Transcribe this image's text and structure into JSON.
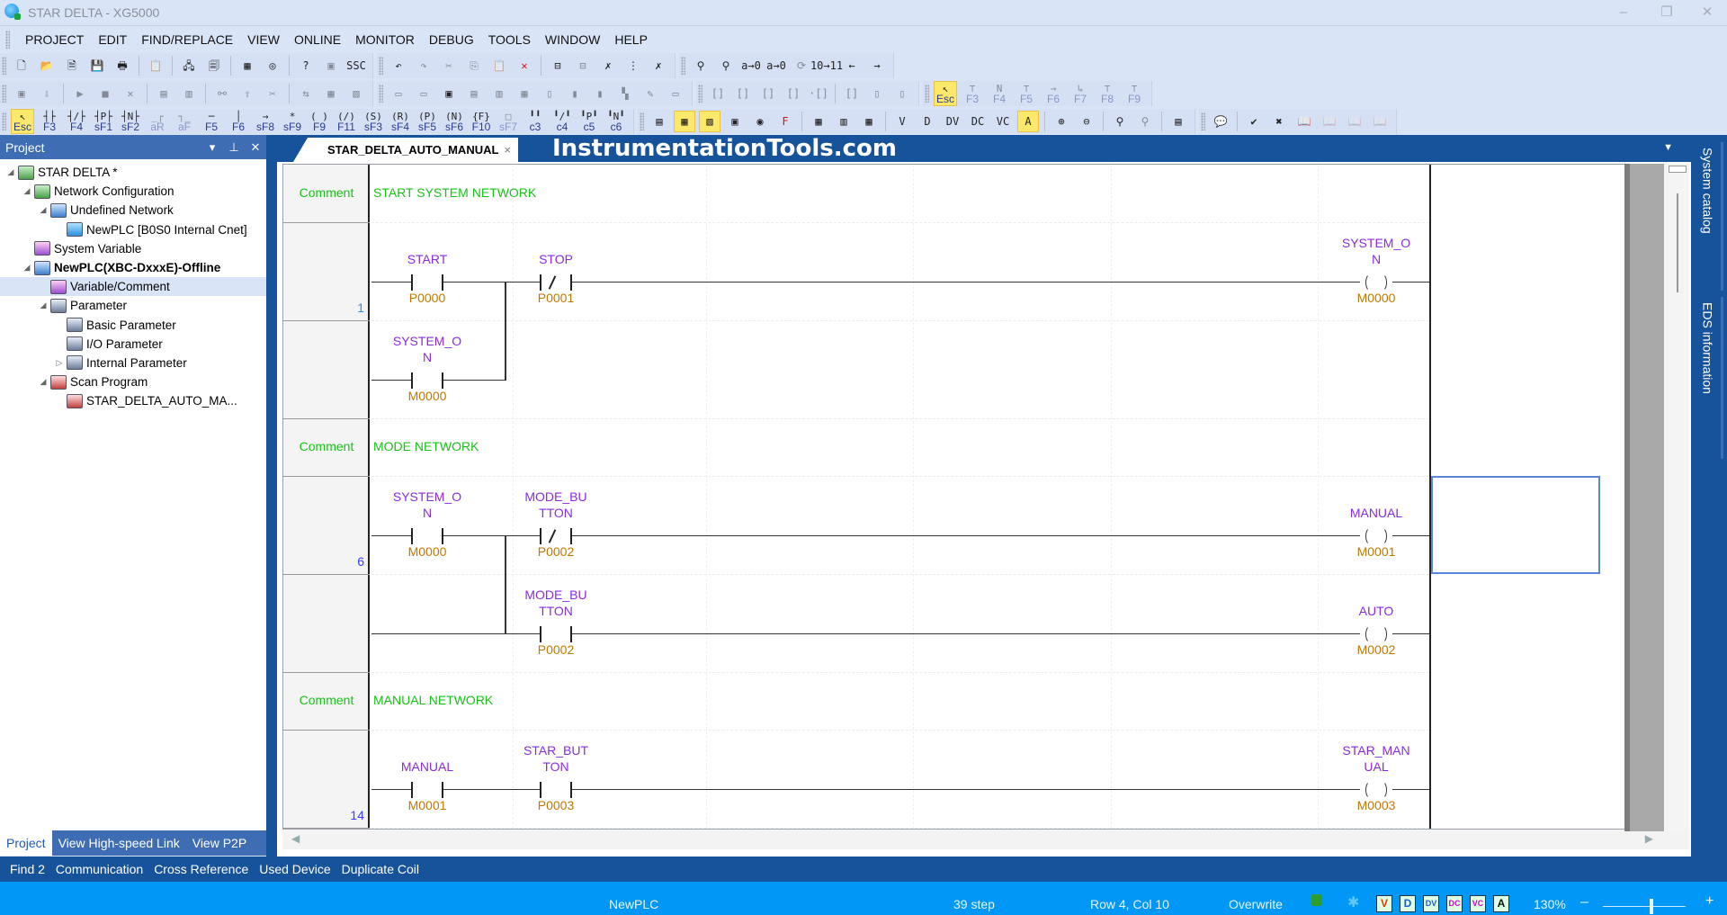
{
  "window": {
    "title": "STAR DELTA - XG5000",
    "minimize": "–",
    "restore": "❐",
    "close": "✕"
  },
  "menu": [
    "PROJECT",
    "EDIT",
    "FIND/REPLACE",
    "VIEW",
    "ONLINE",
    "MONITOR",
    "DEBUG",
    "TOOLS",
    "WINDOW",
    "HELP"
  ],
  "toolbar": {
    "row1": [
      {
        "name": "new-project-icon",
        "glyph": "🗋"
      },
      {
        "name": "open-project-icon",
        "glyph": "📂"
      },
      {
        "name": "open-from-plc-icon",
        "glyph": "🗎"
      },
      {
        "name": "save-icon",
        "glyph": "💾"
      },
      {
        "name": "print-icon",
        "glyph": "🖶"
      },
      {
        "name": "sep"
      },
      {
        "name": "clipboard-icon",
        "glyph": "📋",
        "dis": true
      },
      {
        "name": "sep"
      },
      {
        "name": "connect-icon",
        "glyph": "🖧"
      },
      {
        "name": "project-compare-icon",
        "glyph": "🗐"
      },
      {
        "name": "sep"
      },
      {
        "name": "io-sync-icon",
        "glyph": "▦"
      },
      {
        "name": "variable-icon",
        "glyph": "◎"
      },
      {
        "name": "sep"
      },
      {
        "name": "help-icon",
        "glyph": "?"
      },
      {
        "name": "help-topics-icon",
        "glyph": "▣",
        "dis": true
      },
      {
        "name": "ssc-icon",
        "glyph": "SSC"
      },
      {
        "name": "grp"
      },
      {
        "name": "undo-icon",
        "glyph": "↶"
      },
      {
        "name": "redo-icon",
        "glyph": "↷",
        "dis": true
      },
      {
        "name": "cut-icon",
        "glyph": "✂",
        "dis": true
      },
      {
        "name": "copy-icon",
        "glyph": "⎘",
        "dis": true
      },
      {
        "name": "paste-icon",
        "glyph": "📋",
        "dis": true
      },
      {
        "name": "delete-icon",
        "glyph": "✕",
        "red": true
      },
      {
        "name": "sep"
      },
      {
        "name": "insert-line-icon",
        "glyph": "⊟"
      },
      {
        "name": "delete-line-icon",
        "glyph": "⊟",
        "dis": true
      },
      {
        "name": "delete-cell-icon",
        "glyph": "✗"
      },
      {
        "name": "insert-column-icon",
        "glyph": "⋮"
      },
      {
        "name": "delete-column-icon",
        "glyph": "✗"
      },
      {
        "name": "grp"
      },
      {
        "name": "find-device-icon",
        "glyph": "⚲"
      },
      {
        "name": "find-icon",
        "glyph": "⚲"
      },
      {
        "name": "replace-device-icon",
        "glyph": "a→0"
      },
      {
        "name": "replace-icon",
        "glyph": "a→0"
      },
      {
        "name": "find-again-icon",
        "glyph": "⟳",
        "dis": true
      },
      {
        "name": "goto-step-icon",
        "glyph": "10→11"
      },
      {
        "name": "back-icon",
        "glyph": "←"
      },
      {
        "name": "forward-icon",
        "glyph": "→"
      }
    ],
    "row2": [
      {
        "name": "plc-mode-icon",
        "glyph": "▣",
        "dis": true
      },
      {
        "name": "write-icon",
        "glyph": "⇩",
        "dis": true
      },
      {
        "name": "sep"
      },
      {
        "name": "run-icon",
        "glyph": "▶",
        "dis": true
      },
      {
        "name": "stop-icon",
        "glyph": "■",
        "dis": true
      },
      {
        "name": "pause-icon",
        "glyph": "✕",
        "dis": true
      },
      {
        "name": "sep"
      },
      {
        "name": "reset-icon",
        "glyph": "▤",
        "dis": true
      },
      {
        "name": "clear-icon",
        "glyph": "▥",
        "dis": true
      },
      {
        "name": "sep"
      },
      {
        "name": "connect-plc-icon",
        "glyph": "⚯",
        "dis": true
      },
      {
        "name": "read-icon",
        "glyph": "⇧",
        "dis": true
      },
      {
        "name": "disconnect-icon",
        "glyph": "✂",
        "dis": true
      },
      {
        "name": "sep"
      },
      {
        "name": "compare-icon",
        "glyph": "⇆",
        "dis": true
      },
      {
        "name": "online-edit-icon",
        "glyph": "▦",
        "dis": true
      },
      {
        "name": "save-program-icon",
        "glyph": "▧",
        "dis": true
      },
      {
        "name": "grp"
      },
      {
        "name": "monitor-start-icon",
        "glyph": "▭",
        "dis": true
      },
      {
        "name": "monitor-pause-icon",
        "glyph": "▭",
        "dis": true
      },
      {
        "name": "system-monitor-icon",
        "glyph": "▣"
      },
      {
        "name": "device-monitor-icon",
        "glyph": "▤",
        "dis": true
      },
      {
        "name": "special-module-icon",
        "glyph": "▥",
        "dis": true
      },
      {
        "name": "trend-monitor-icon",
        "glyph": "▦",
        "dis": true
      },
      {
        "name": "custom-event-icon",
        "glyph": "▯",
        "dis": true
      },
      {
        "name": "data-trace-icon",
        "glyph": "▮",
        "dis": true
      },
      {
        "name": "io-info-icon",
        "glyph": "▮",
        "dis": true
      },
      {
        "name": "ladder-monitor-icon",
        "glyph": "▚",
        "dis": true
      },
      {
        "name": "edit-comment-icon",
        "glyph": "✎",
        "dis": true
      },
      {
        "name": "debug-icon",
        "glyph": "▭",
        "dis": true
      },
      {
        "name": "grp"
      },
      {
        "name": "step-in-icon",
        "glyph": "[]",
        "dis": true
      },
      {
        "name": "step-over-icon",
        "glyph": "[]",
        "dis": true
      },
      {
        "name": "step-out-icon",
        "glyph": "[]",
        "dis": true
      },
      {
        "name": "goto-cursor-icon",
        "glyph": "[]",
        "dis": true
      },
      {
        "name": "breakpoint-icon",
        "glyph": "·[]",
        "dis": true
      },
      {
        "name": "sep"
      },
      {
        "name": "breakpoint-list-icon",
        "glyph": "[]",
        "dis": true
      },
      {
        "name": "break-condition-icon",
        "glyph": "▯",
        "dis": true
      },
      {
        "name": "watch-icon",
        "glyph": "▯",
        "dis": true
      },
      {
        "name": "grp"
      },
      {
        "name": "select-mode-icon",
        "glyph": "↖",
        "key": "Esc",
        "sel": true
      },
      {
        "name": "sfc-step-icon",
        "glyph": "⊤",
        "key": "F3",
        "dis": true
      },
      {
        "name": "sfc-transition-icon",
        "glyph": "N",
        "key": "F4",
        "dis": true
      },
      {
        "name": "sfc-branch-icon",
        "glyph": "⊤",
        "key": "F5",
        "dis": true
      },
      {
        "name": "sfc-jump-icon",
        "glyph": "→",
        "key": "F6",
        "dis": true
      },
      {
        "name": "sfc-end-icon",
        "glyph": "↳",
        "key": "F7",
        "dis": true
      },
      {
        "name": "sfc-div-icon",
        "glyph": "⊤",
        "key": "F8",
        "dis": true
      },
      {
        "name": "sfc-conv-icon",
        "glyph": "⊤",
        "key": "F9",
        "dis": true
      }
    ],
    "row3": [
      {
        "name": "select-mode-icon",
        "glyph": "↖",
        "key": "Esc",
        "sel": true
      },
      {
        "name": "normally-open-contact-icon",
        "glyph": "┤├",
        "key": "F3"
      },
      {
        "name": "normally-closed-contact-icon",
        "glyph": "┤/├",
        "key": "F4"
      },
      {
        "name": "positive-transition-contact-icon",
        "glyph": "┤P├",
        "key": "sF1"
      },
      {
        "name": "negative-transition-contact-icon",
        "glyph": "┤N├",
        "key": "sF2"
      },
      {
        "name": "rising-edge-icon",
        "glyph": "_┌",
        "key": "aR",
        "dis": true
      },
      {
        "name": "falling-edge-icon",
        "glyph": "┐_",
        "key": "aF",
        "dis": true
      },
      {
        "name": "horizontal-line-icon",
        "glyph": "─",
        "key": "F5"
      },
      {
        "name": "vertical-line-icon",
        "glyph": "│",
        "key": "F6"
      },
      {
        "name": "connect-line-icon",
        "glyph": "→",
        "key": "sF8"
      },
      {
        "name": "invert-icon",
        "glyph": "*",
        "key": "sF9"
      },
      {
        "name": "coil-icon",
        "glyph": "( )",
        "key": "F9"
      },
      {
        "name": "negated-coil-icon",
        "glyph": "(/)",
        "key": "F11"
      },
      {
        "name": "set-coil-icon",
        "glyph": "(S)",
        "key": "sF3"
      },
      {
        "name": "reset-coil-icon",
        "glyph": "(R)",
        "key": "sF4"
      },
      {
        "name": "positive-coil-icon",
        "glyph": "(P)",
        "key": "sF5"
      },
      {
        "name": "negative-coil-icon",
        "glyph": "(N)",
        "key": "sF6"
      },
      {
        "name": "function-icon",
        "glyph": "{F}",
        "key": "F10"
      },
      {
        "name": "function-block-icon",
        "glyph": "□",
        "key": "sF7",
        "dis": true
      },
      {
        "name": "c3-icon",
        "glyph": "╹╹",
        "key": "c3"
      },
      {
        "name": "c4-icon",
        "glyph": "╹/╹",
        "key": "c4"
      },
      {
        "name": "c5-icon",
        "glyph": "╹P╹",
        "key": "c5"
      },
      {
        "name": "c6-icon",
        "glyph": "╹N╹",
        "key": "c6"
      },
      {
        "name": "grp"
      },
      {
        "name": "project-window-icon",
        "glyph": "▤"
      },
      {
        "name": "variable-window-icon",
        "glyph": "▦",
        "sel": true
      },
      {
        "name": "message-window-icon",
        "glyph": "▧",
        "sel": true
      },
      {
        "name": "result-window-icon",
        "glyph": "▣"
      },
      {
        "name": "monitor-window-icon",
        "glyph": "◉"
      },
      {
        "name": "function-window-icon",
        "glyph": "F",
        "red": true
      },
      {
        "name": "sep"
      },
      {
        "name": "local-variable-icon",
        "glyph": "▦"
      },
      {
        "name": "io-map-icon",
        "glyph": "▥"
      },
      {
        "name": "device-view-icon",
        "glyph": "▦"
      },
      {
        "name": "sep"
      },
      {
        "name": "view-variable-icon",
        "glyph": "V"
      },
      {
        "name": "view-device-icon",
        "glyph": "D"
      },
      {
        "name": "view-device-variable-icon",
        "glyph": "DV"
      },
      {
        "name": "view-device-comment-icon",
        "glyph": "DC"
      },
      {
        "name": "view-variable-comment-icon",
        "glyph": "VC"
      },
      {
        "name": "view-address-icon",
        "glyph": "A",
        "sel": true
      },
      {
        "name": "sep"
      },
      {
        "name": "zoom-in-icon",
        "glyph": "⊕"
      },
      {
        "name": "zoom-out-icon",
        "glyph": "⊖"
      },
      {
        "name": "sep"
      },
      {
        "name": "find-contact-icon",
        "glyph": "⚲"
      },
      {
        "name": "find-coil-icon",
        "glyph": "⚲",
        "dis": true
      },
      {
        "name": "sep"
      },
      {
        "name": "compile-icon",
        "glyph": "▤"
      },
      {
        "name": "grp"
      },
      {
        "name": "comment-icon",
        "glyph": "💬"
      },
      {
        "name": "sep"
      },
      {
        "name": "check-program-icon",
        "glyph": "✔"
      },
      {
        "name": "check-error-icon",
        "glyph": "✖"
      },
      {
        "name": "bookmark-icon",
        "glyph": "📖"
      },
      {
        "name": "bookmark-clear-icon",
        "glyph": "📖",
        "dis": true
      },
      {
        "name": "bookmark-prev-icon",
        "glyph": "📖",
        "dis": true
      },
      {
        "name": "bookmark-next-icon",
        "glyph": "📖",
        "dis": true
      }
    ]
  },
  "project_panel": {
    "title": "Project",
    "controls": {
      "dropdown": "▾",
      "pin": "⊥",
      "close": "✕"
    },
    "tree": [
      {
        "label": "STAR DELTA *",
        "level": 0,
        "exp": "◢",
        "icon": "network"
      },
      {
        "label": "Network Configuration",
        "level": 1,
        "exp": "◢",
        "icon": "network"
      },
      {
        "label": "Undefined Network",
        "level": 2,
        "exp": "◢",
        "icon": "module"
      },
      {
        "label": "NewPLC [B0S0 Internal Cnet]",
        "level": 3,
        "exp": "",
        "icon": "plc"
      },
      {
        "label": "System Variable",
        "level": 1,
        "exp": "",
        "icon": "variable"
      },
      {
        "label": "NewPLC(XBC-DxxxE)-Offline",
        "level": 1,
        "exp": "◢",
        "icon": "module",
        "bold": true
      },
      {
        "label": "Variable/Comment",
        "level": 2,
        "exp": "",
        "icon": "variable",
        "selected": true
      },
      {
        "label": "Parameter",
        "level": 2,
        "exp": "◢",
        "icon": "parameter"
      },
      {
        "label": "Basic Parameter",
        "level": 3,
        "exp": "",
        "icon": "parameter"
      },
      {
        "label": "I/O Parameter",
        "level": 3,
        "exp": "",
        "icon": "parameter"
      },
      {
        "label": "Internal Parameter",
        "level": 3,
        "exp": "▷",
        "icon": "parameter"
      },
      {
        "label": "Scan Program",
        "level": 2,
        "exp": "◢",
        "icon": "program"
      },
      {
        "label": "STAR_DELTA_AUTO_MA...",
        "level": 3,
        "exp": "",
        "icon": "program"
      }
    ],
    "tabs": [
      {
        "label": "Project",
        "active": true
      },
      {
        "label": "View High-speed Link"
      },
      {
        "label": "View P2P"
      }
    ]
  },
  "editor": {
    "tab_label": "STAR_DELTA_AUTO_MANUAL",
    "tab_close": "×",
    "watermark": "InstrumentationTools.com",
    "dropdown": "▼",
    "comment_label": "Comment",
    "networks": [
      {
        "comment": "START SYSTEM NETWORK",
        "step": "1",
        "rows": [
          {
            "contacts": [
              {
                "var": [
                  "START"
                ],
                "dev": "P0000",
                "type": "NO"
              },
              {
                "var": [
                  "STOP"
                ],
                "dev": "P0001",
                "type": "NC"
              }
            ],
            "coil": {
              "var": [
                "SYSTEM_O",
                "N"
              ],
              "dev": "M0000"
            }
          },
          {
            "contacts": [
              {
                "var": [
                  "SYSTEM_O",
                  "N"
                ],
                "dev": "M0000",
                "type": "NO"
              }
            ],
            "branch_to": 1
          }
        ]
      },
      {
        "comment": "MODE NETWORK",
        "step": "6",
        "rows": [
          {
            "contacts": [
              {
                "var": [
                  "SYSTEM_O",
                  "N"
                ],
                "dev": "M0000",
                "type": "NO"
              },
              {
                "var": [
                  "MODE_BU",
                  "TTON"
                ],
                "dev": "P0002",
                "type": "NC"
              }
            ],
            "coil": {
              "var": [
                "MANUAL"
              ],
              "dev": "M0001"
            }
          },
          {
            "contacts": [
              null,
              {
                "var": [
                  "MODE_BU",
                  "TTON"
                ],
                "dev": "P0002",
                "type": "NO"
              }
            ],
            "coil": {
              "var": [
                "AUTO"
              ],
              "dev": "M0002"
            }
          }
        ]
      },
      {
        "comment": "MANUAL NETWORK",
        "step": "14",
        "rows": [
          {
            "contacts": [
              {
                "var": [
                  "MANUAL"
                ],
                "dev": "M0001",
                "type": "NO"
              },
              {
                "var": [
                  "STAR_BUT",
                  "TON"
                ],
                "dev": "P0003",
                "type": "NO"
              }
            ],
            "coil": {
              "var": [
                "STAR_MAN",
                "UAL"
              ],
              "dev": "M0003"
            }
          }
        ]
      }
    ]
  },
  "side_tabs": [
    "System catalog",
    "EDS information"
  ],
  "output_tabs": [
    "Find 2",
    "Communication",
    "Cross Reference",
    "Used Device",
    "Duplicate Coil"
  ],
  "status": {
    "plc": "NewPLC",
    "steps": "39 step",
    "position": "Row 4, Col 10",
    "mode": "Overwrite",
    "zoom": "130%",
    "zoom_minus": "–",
    "zoom_plus": "+",
    "zoom_level_fraction": 0.6,
    "view_icons": [
      {
        "name": "view-variable-icon",
        "glyph": "V"
      },
      {
        "name": "view-device-icon",
        "glyph": "D"
      },
      {
        "name": "view-device-variable-icon",
        "glyph": "DV"
      },
      {
        "name": "view-device-comment-icon",
        "glyph": "DC"
      },
      {
        "name": "view-variable-comment-icon",
        "glyph": "VC"
      },
      {
        "name": "view-address-icon",
        "glyph": "A"
      }
    ]
  },
  "colors": {
    "accent": "#17539b",
    "panel_header": "#3e6db3",
    "status_bar": "#0097f6",
    "comment_green": "#15c415",
    "variable_purple": "#8a2be2",
    "device_orange": "#c07800",
    "step_blue": "#3a3aff"
  }
}
